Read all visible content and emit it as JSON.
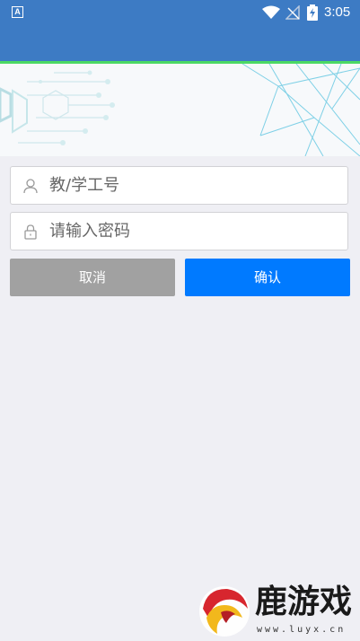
{
  "status_bar": {
    "time": "3:05",
    "a_badge": "A"
  },
  "form": {
    "username_placeholder": "教/学工号",
    "password_placeholder": "请输入密码",
    "cancel_label": "取消",
    "confirm_label": "确认"
  },
  "colors": {
    "status_bar": "#3d7bc4",
    "accent_line": "#4cd964",
    "confirm_button": "#007aff",
    "cancel_button": "#a1a1a1",
    "background": "#efeff4"
  },
  "watermark": {
    "brand": "鹿游戏",
    "url": "www.luyx.cn"
  },
  "icons": [
    "a-badge-icon",
    "wifi-icon",
    "no-signal-icon",
    "battery-charging-icon",
    "user-icon",
    "lock-icon"
  ]
}
